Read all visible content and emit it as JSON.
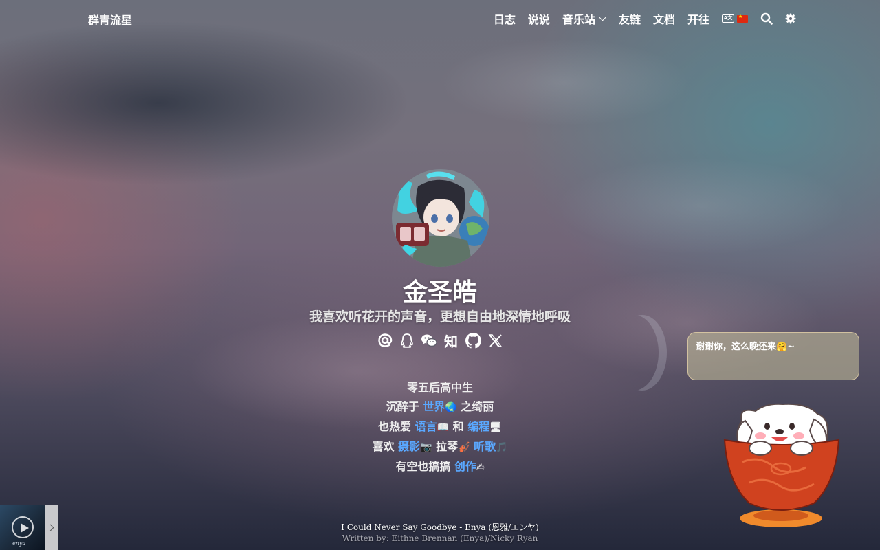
{
  "nav": {
    "brand": "群青流星",
    "items": [
      {
        "label": "日志"
      },
      {
        "label": "说说"
      },
      {
        "label": "音乐站"
      },
      {
        "label": "友链"
      },
      {
        "label": "文档"
      },
      {
        "label": "开往"
      }
    ],
    "language_icon": "translate-icon",
    "language_flag": "cn-flag-icon",
    "search_icon": "search-icon",
    "settings_icon": "gear-icon"
  },
  "profile": {
    "name": "金圣皓",
    "motto": "我喜欢听花开的声音，更想自由地深情地呼吸",
    "socials": [
      {
        "icon": "at-email-icon"
      },
      {
        "icon": "qq-icon"
      },
      {
        "icon": "wechat-icon"
      },
      {
        "icon": "zhihu-icon",
        "text": "知"
      },
      {
        "icon": "github-icon"
      },
      {
        "icon": "x-twitter-icon"
      }
    ]
  },
  "bio": {
    "line1": "零五后高中生",
    "line2_prefix": "沉醉于 ",
    "line2_link": "世界",
    "line2_emoji": "🌏",
    "line2_suffix": " 之绮丽",
    "line3_prefix": "也热爱 ",
    "line3_link1": "语言",
    "line3_emoji1": "📖",
    "line3_mid": " 和 ",
    "line3_link2": "编程",
    "line3_emoji2": "🖥",
    "line4_prefix": "喜欢 ",
    "line4_link1": "摄影",
    "line4_emoji1": "📷",
    "line4_mid": " 拉琴",
    "line4_emoji2": "🎻",
    "line4_link2": " 听歌",
    "line4_emoji3": "🎵",
    "line5_prefix": "有空也搞搞 ",
    "line5_link": "创作",
    "line5_emoji": "✍"
  },
  "song": {
    "title": "I Could Never Say Goodbye - Enya (恩雅/エンヤ)",
    "written_by": "Written by:  Eithne Brennan (Enya)/Nicky Ryan"
  },
  "player": {
    "cover_label": "enya",
    "play_icon": "play-icon",
    "toggle_icon": "chevron-right-icon"
  },
  "mascot": {
    "message": "谢谢你，这么晚还来🤗~"
  },
  "colors": {
    "link": "#5aa8ff",
    "text": "#f2f2f2"
  }
}
